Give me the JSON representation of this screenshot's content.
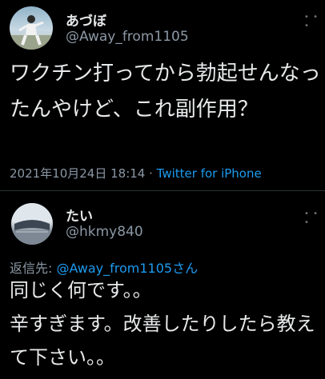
{
  "tweet": {
    "user_name": "あづぼ",
    "handle": "@Away_from1105",
    "text": "ワクチン打ってから勃起せんなったんやけど、これ副作用？",
    "timestamp": "2021年10月24日 18:14",
    "separator": " · ",
    "source": "Twitter for iPhone"
  },
  "reply": {
    "user_name": "たい",
    "handle": "@hkmy840",
    "reply_to_label": "返信先: ",
    "reply_to_mention": "@Away_from1105さん",
    "text_line1": "同じく何です。。",
    "text_line2": "辛すぎます。改善したりしたら教えて下さい。。"
  },
  "icons": {
    "more": "more-dots-icon"
  },
  "colors": {
    "background": "#000000",
    "text": "#e7e9ea",
    "secondary": "#8b98a5",
    "link": "#1d9bf0"
  }
}
